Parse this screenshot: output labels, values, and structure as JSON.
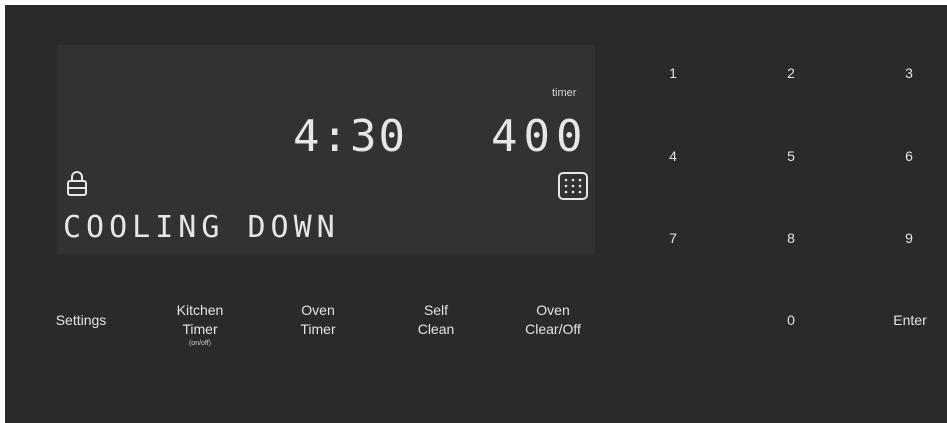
{
  "display": {
    "clock": "4:30",
    "temperature": "400",
    "timer_label": "timer",
    "status": "COOLING DOWN",
    "icons": {
      "lock": "lock-icon",
      "self_clean": "self-clean-grid-icon"
    }
  },
  "buttons": {
    "settings": "Settings",
    "kitchen_timer_line1": "Kitchen",
    "kitchen_timer_line2": "Timer",
    "kitchen_timer_sub": "(on/off)",
    "oven_timer_line1": "Oven",
    "oven_timer_line2": "Timer",
    "self_clean_line1": "Self",
    "self_clean_line2": "Clean",
    "oven_clear_line1": "Oven",
    "oven_clear_line2": "Clear/Off"
  },
  "keypad": {
    "k1": "1",
    "k2": "2",
    "k3": "3",
    "k4": "4",
    "k5": "5",
    "k6": "6",
    "k7": "7",
    "k8": "8",
    "k9": "9",
    "k0": "0",
    "enter": "Enter"
  },
  "colors": {
    "panel": "#2a2a2a",
    "display": "#323232",
    "text": "#e4e4e4"
  }
}
